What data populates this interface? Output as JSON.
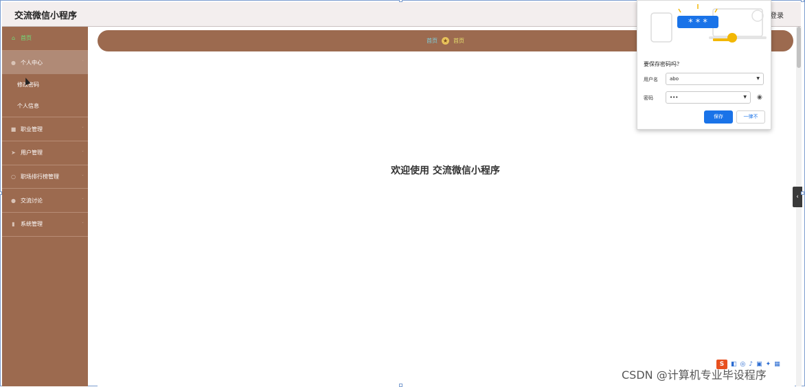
{
  "app": {
    "title": "交流微信小程序",
    "login": "登录"
  },
  "sidebar": {
    "items": [
      {
        "label": "首页",
        "icon": "home-icon"
      },
      {
        "label": "个人中心",
        "icon": "user-icon",
        "children": [
          "修改密码",
          "个人信息"
        ]
      },
      {
        "label": "职业管理",
        "icon": "briefcase-icon"
      },
      {
        "label": "用户管理",
        "icon": "send-icon"
      },
      {
        "label": "职场排行榜管理",
        "icon": "ranking-icon"
      },
      {
        "label": "交流讨论",
        "icon": "discussion-icon"
      },
      {
        "label": "系统管理",
        "icon": "settings-chart-icon"
      }
    ]
  },
  "breadcrumb": {
    "first": "首页",
    "second": "首页"
  },
  "main": {
    "welcome": "欢迎使用 交流微信小程序"
  },
  "password_popup": {
    "title": "要保存密码吗？",
    "username_label": "用户名",
    "username_value": "abo",
    "password_label": "密码",
    "password_value": "•••",
    "save_button": "保存",
    "never_button": "一律不",
    "illustration_text": "* * *"
  },
  "watermark": "CSDN @计算机专业毕设程序",
  "taskbar": {
    "logo": "S"
  },
  "colors": {
    "sidebar": "#9c6a4f",
    "accent_blue": "#1a73e8",
    "home_green": "#6ee07a"
  }
}
